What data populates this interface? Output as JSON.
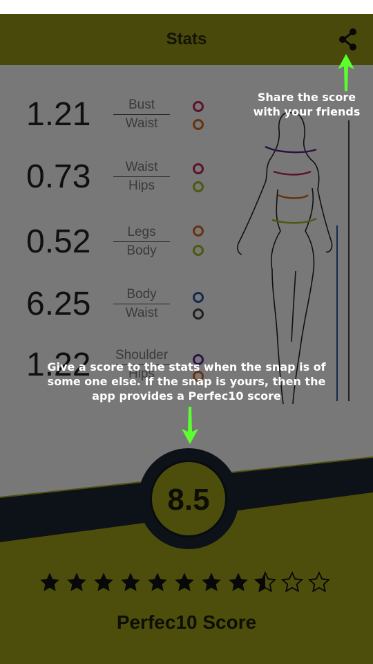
{
  "app": {
    "title": "Stats",
    "share_icon": "share-icon"
  },
  "stats": [
    {
      "value": "1.21",
      "top_label": "Bust",
      "bottom_label": "Waist",
      "top_color": "#c0245c",
      "bottom_color": "#d86a1e"
    },
    {
      "value": "0.73",
      "top_label": "Waist",
      "bottom_label": "Hips",
      "top_color": "#c0245c",
      "bottom_color": "#a6b820"
    },
    {
      "value": "0.52",
      "top_label": "Legs",
      "bottom_label": "Body",
      "top_color": "#d86a1e",
      "bottom_color": "#a6b820"
    },
    {
      "value": "6.25",
      "top_label": "Body",
      "bottom_label": "Waist",
      "top_color": "#2a5aa0",
      "bottom_color": "#444444"
    },
    {
      "value": "1.22",
      "top_label": "Shoulder",
      "bottom_label": "Hips",
      "top_color": "#5a2a90",
      "bottom_color": "#d86a1e"
    }
  ],
  "score": {
    "value": "8.5",
    "rating_out_of": 10,
    "rating": 8.5,
    "label": "Perfec10 Score"
  },
  "hints": {
    "share": "Share the score with your friends",
    "score": "Give a score to the stats when the snap is of some one else. If the snap is yours, then the app provides a Perfec10 score"
  },
  "colors": {
    "appbar": "#9a9a1a",
    "accent_arrow": "#5cff2e",
    "score_ring": "#1a2630"
  }
}
